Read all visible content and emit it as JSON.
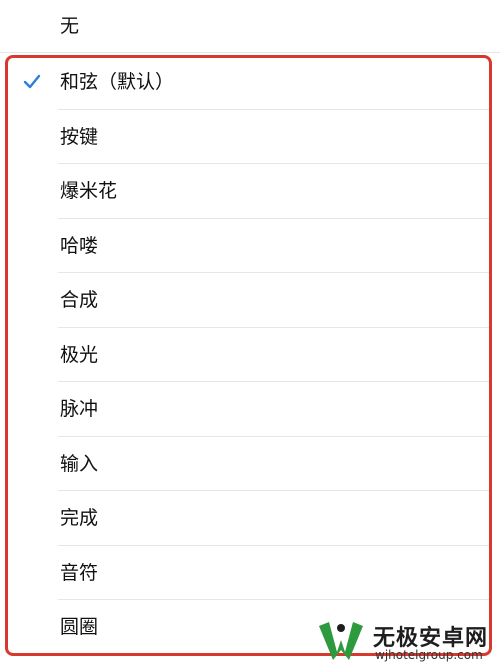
{
  "top_option": {
    "label": "无"
  },
  "options": [
    {
      "label": "和弦（默认）",
      "selected": true
    },
    {
      "label": "按键",
      "selected": false
    },
    {
      "label": "爆米花",
      "selected": false
    },
    {
      "label": "哈喽",
      "selected": false
    },
    {
      "label": "合成",
      "selected": false
    },
    {
      "label": "极光",
      "selected": false
    },
    {
      "label": "脉冲",
      "selected": false
    },
    {
      "label": "输入",
      "selected": false
    },
    {
      "label": "完成",
      "selected": false
    },
    {
      "label": "音符",
      "selected": false
    },
    {
      "label": "圆圈",
      "selected": false
    }
  ],
  "colors": {
    "highlight_border": "#d8392f",
    "check_mark": "#2a7de1",
    "watermark_green": "#2e9a3e",
    "watermark_dark": "#1e1e1e"
  },
  "icons": {
    "selected": "check-icon",
    "watermark_logo": "wm-logo-icon"
  },
  "watermark": {
    "title": "无极安卓网",
    "url": "wjhotelgroup.com"
  }
}
